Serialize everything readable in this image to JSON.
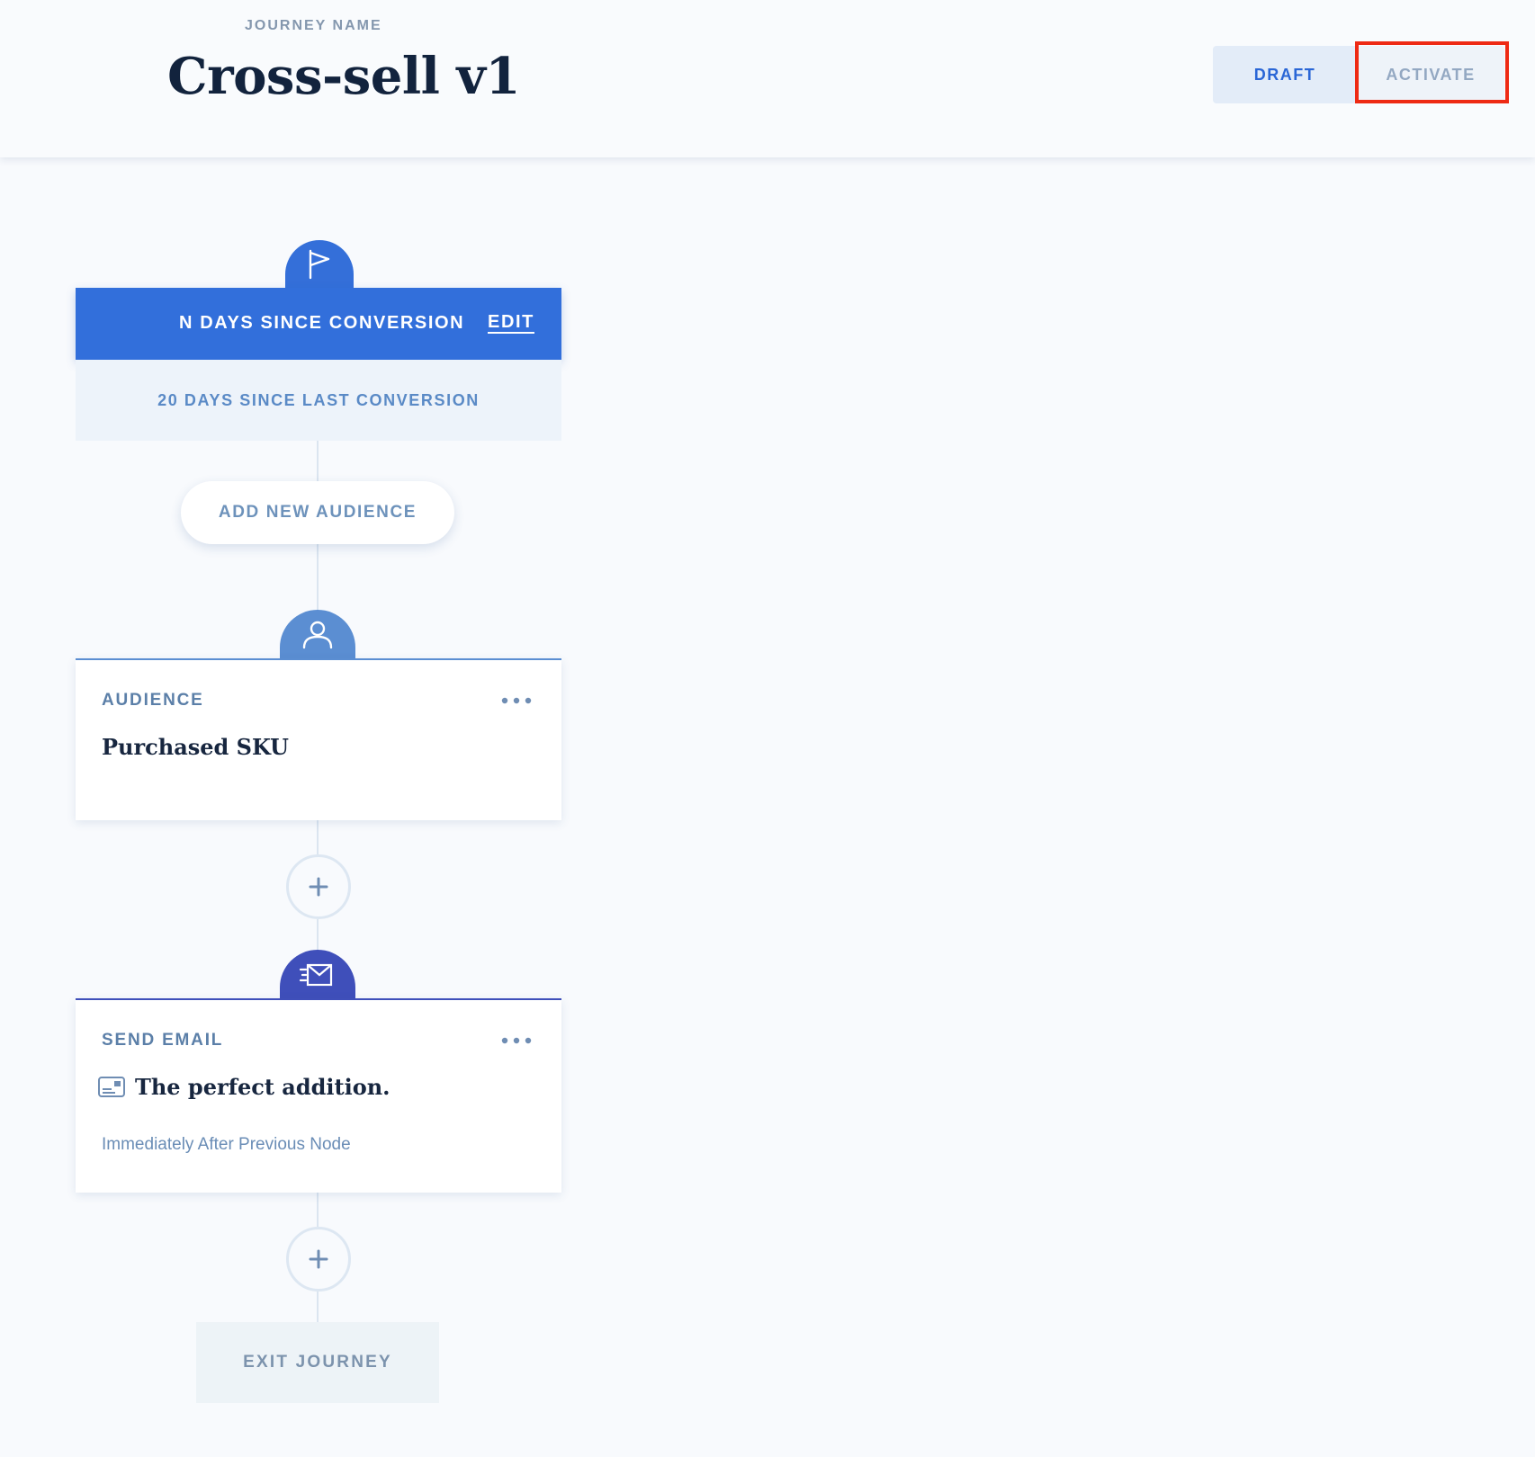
{
  "header": {
    "journey_label": "JOURNEY NAME",
    "journey_title": "Cross-sell v1",
    "draft_label": "DRAFT",
    "activate_label": "ACTIVATE"
  },
  "trigger": {
    "title": "N DAYS SINCE CONVERSION",
    "edit_label": "EDIT",
    "detail": "20 DAYS SINCE LAST CONVERSION",
    "icon": "flag-icon"
  },
  "add_audience_label": "ADD NEW AUDIENCE",
  "audience_node": {
    "type_label": "AUDIENCE",
    "title": "Purchased SKU",
    "icon": "user-icon"
  },
  "email_node": {
    "type_label": "SEND EMAIL",
    "title": "The perfect addition.",
    "timing": "Immediately After Previous Node",
    "icon": "send-email-icon"
  },
  "exit_label": "EXIT JOURNEY",
  "colors": {
    "primary_blue": "#326fdb",
    "audience_blue": "#5b8ed2",
    "email_indigo": "#3f4fba",
    "highlight_red": "#ee2a14"
  }
}
